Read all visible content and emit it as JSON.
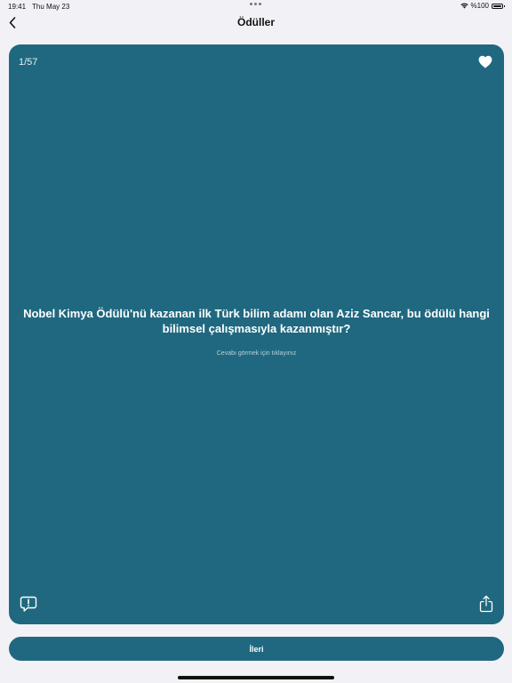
{
  "status_bar": {
    "time": "19:41",
    "date": "Thu May 23",
    "battery": "%100",
    "icons": [
      "wifi-icon",
      "battery-icon"
    ]
  },
  "nav": {
    "title": "Ödüller",
    "back_icon": "chevron-left-icon"
  },
  "card": {
    "counter": "1/57",
    "question": "Nobel Kimya Ödülü'nü kazanan ilk Türk bilim adamı olan Aziz Sancar, bu ödülü hangi bilimsel çalışmasıyla kazanmıştır?",
    "hint": "Cevabı görmek için tıklayınız",
    "background_color": "#20687f",
    "icons": {
      "favorite": "heart-icon",
      "report": "exclamation-bubble-icon",
      "share": "share-icon"
    }
  },
  "actions": {
    "next_label": "İleri"
  },
  "colors": {
    "accent": "#20687f",
    "background": "#f2f2f6"
  }
}
